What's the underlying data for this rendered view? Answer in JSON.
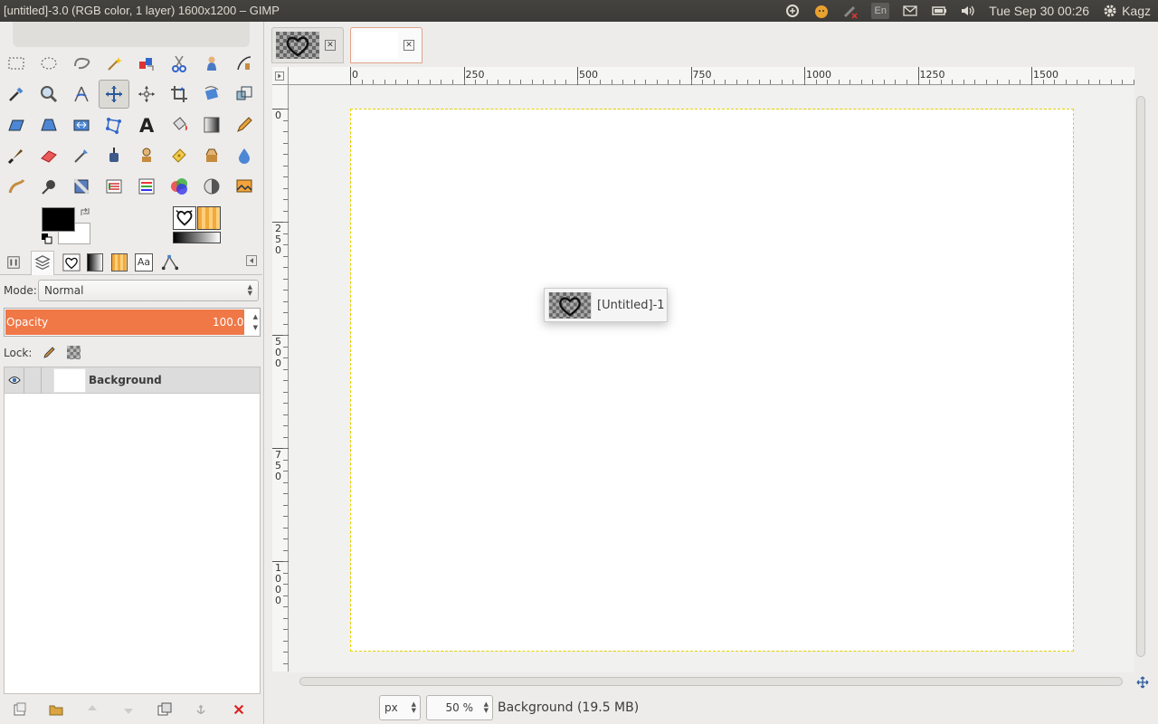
{
  "topbar": {
    "window_title": "[untitled]-3.0 (RGB color, 1 layer) 1600x1200 – GIMP",
    "keyboard_layout": "En",
    "clock": "Tue Sep 30 00:26",
    "user": "Kagz"
  },
  "toolbox": {
    "tools": [
      "rect-select",
      "ellipse-select",
      "free-select",
      "fuzzy-select",
      "select-by-color",
      "scissors-select",
      "foreground-select",
      "paths",
      "color-picker",
      "zoom",
      "measure",
      "move",
      "align",
      "crop",
      "rotate",
      "scale",
      "shear",
      "perspective",
      "flip",
      "cage-transform",
      "text",
      "bucket-fill",
      "blend",
      "pencil",
      "paintbrush",
      "eraser",
      "airbrush",
      "ink",
      "clone",
      "heal",
      "perspective-clone",
      "blur",
      "smudge",
      "dodge-burn",
      "desaturate",
      "color-levels",
      "hue-saturation",
      "color-balance",
      "curves",
      "image-preview"
    ],
    "active_tool_index": 11,
    "fg_color": "#000000",
    "bg_color": "#ffffff"
  },
  "layers_dock": {
    "tab_count": 6,
    "mode_label": "Mode:",
    "mode_value": "Normal",
    "opacity_label": "Opacity",
    "opacity_value": "100.0",
    "lock_label": "Lock:",
    "layers": [
      {
        "name": "Background",
        "visible": true
      }
    ]
  },
  "image_window": {
    "tabs": [
      "image-1",
      "image-2"
    ],
    "active_tab": 1,
    "hruler_labels": [
      "0",
      "250",
      "500",
      "750",
      "1000",
      "1250",
      "1500"
    ],
    "vruler_labels": [
      "0",
      "250",
      "500",
      "750",
      "1000"
    ],
    "unit": "px",
    "zoom": "50 %",
    "status": "Background (19.5 MB)",
    "tooltip_label": "[Untitled]-1",
    "accent_color": "#f07746"
  }
}
